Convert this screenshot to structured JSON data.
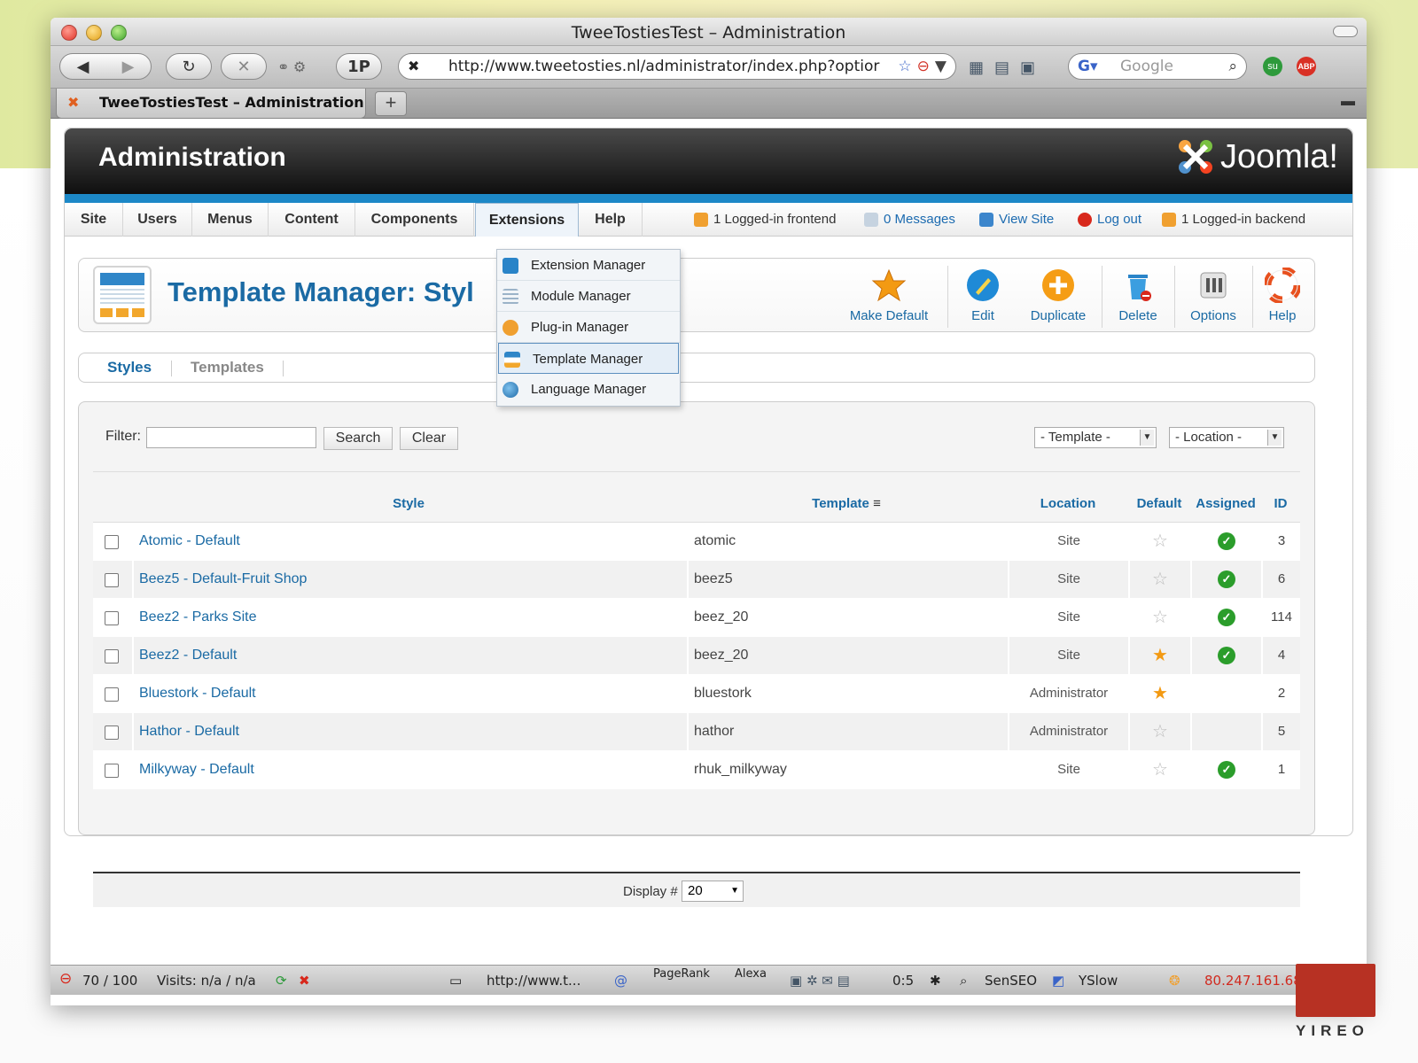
{
  "browser": {
    "window_title": "TweeTostiesTest – Administration",
    "url": "http://www.tweetosties.nl/administrator/index.php?optior",
    "search_placeholder": "Google",
    "tab_title": "TweeTostiesTest – Administration",
    "toolbar_1p": "1P"
  },
  "header": {
    "title": "Administration",
    "brand": "Joomla!"
  },
  "menu": {
    "items": [
      "Site",
      "Users",
      "Menus",
      "Content",
      "Components",
      "Extensions",
      "Help"
    ],
    "active": "Extensions"
  },
  "status": {
    "frontend": "1 Logged-in frontend",
    "messages": "0 Messages",
    "view_site": "View Site",
    "logout": "Log out",
    "backend": "1 Logged-in backend"
  },
  "extensions_dropdown": {
    "items": [
      "Extension Manager",
      "Module Manager",
      "Plug-in Manager",
      "Template Manager",
      "Language Manager"
    ],
    "highlighted": "Template Manager"
  },
  "page": {
    "title": "Template Manager: Styl"
  },
  "toolbar": {
    "make_default": "Make Default",
    "edit": "Edit",
    "duplicate": "Duplicate",
    "delete": "Delete",
    "options": "Options",
    "help": "Help"
  },
  "subtabs": {
    "styles": "Styles",
    "templates": "Templates"
  },
  "filter": {
    "label": "Filter:",
    "value": "",
    "search_button": "Search",
    "clear_button": "Clear",
    "template_select": "- Template -",
    "location_select": "- Location -"
  },
  "table": {
    "columns": [
      "Style",
      "Template",
      "Location",
      "Default",
      "Assigned",
      "ID"
    ],
    "rows": [
      {
        "style": "Atomic - Default",
        "template": "atomic",
        "location": "Site",
        "default": false,
        "assigned": true,
        "id": "3"
      },
      {
        "style": "Beez5 - Default-Fruit Shop",
        "template": "beez5",
        "location": "Site",
        "default": false,
        "assigned": true,
        "id": "6"
      },
      {
        "style": "Beez2 - Parks Site",
        "template": "beez_20",
        "location": "Site",
        "default": false,
        "assigned": true,
        "id": "114"
      },
      {
        "style": "Beez2 - Default",
        "template": "beez_20",
        "location": "Site",
        "default": true,
        "assigned": true,
        "id": "4"
      },
      {
        "style": "Bluestork - Default",
        "template": "bluestork",
        "location": "Administrator",
        "default": true,
        "assigned": false,
        "id": "2"
      },
      {
        "style": "Hathor - Default",
        "template": "hathor",
        "location": "Administrator",
        "default": false,
        "assigned": false,
        "id": "5"
      },
      {
        "style": "Milkyway - Default",
        "template": "rhuk_milkyway",
        "location": "Site",
        "default": false,
        "assigned": true,
        "id": "1"
      }
    ]
  },
  "pagination": {
    "label": "Display #",
    "value": "20"
  },
  "statusbar": {
    "score": "70 / 100",
    "visits": "Visits: n/a / n/a",
    "url": "http://www.t...",
    "pagerank": "PageRank",
    "alexa": "Alexa",
    "time": "0:5",
    "senseo": "SenSEO",
    "yslow": "YSlow",
    "ip": "80.247.161.68"
  },
  "watermark": "YIREO",
  "colors": {
    "link_blue": "#1a6aa4",
    "joomla_strip": "#1c88c7",
    "star_on": "#f39a13",
    "check_green": "#2b9d2b",
    "ip_red": "#d12a1f"
  }
}
